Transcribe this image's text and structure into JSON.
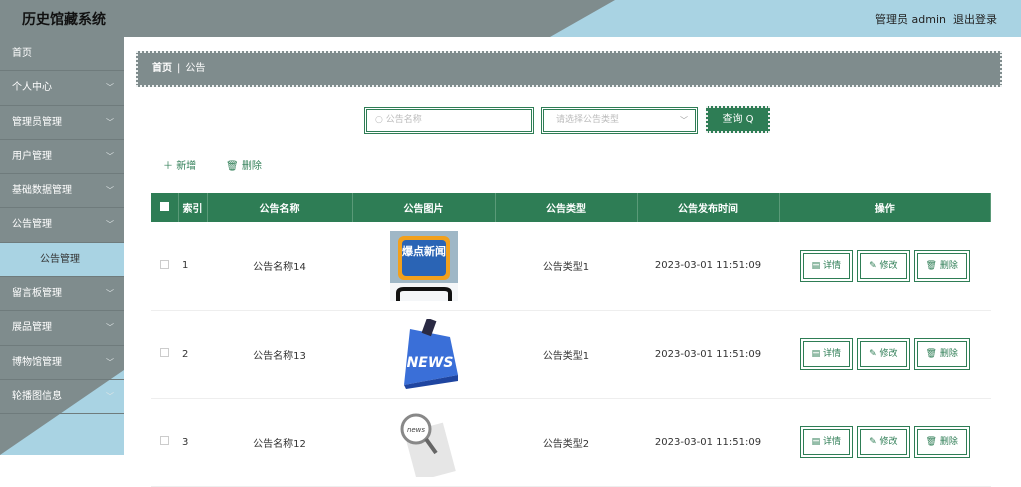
{
  "header": {
    "title": "历史馆藏系统",
    "user": "管理员 admin",
    "logout": "退出登录"
  },
  "sidebar": {
    "items": [
      {
        "label": "首页",
        "chev": ""
      },
      {
        "label": "个人中心",
        "chev": "﹀"
      },
      {
        "label": "管理员管理",
        "chev": "﹀"
      },
      {
        "label": "用户管理",
        "chev": "﹀"
      },
      {
        "label": "基础数据管理",
        "chev": "﹀"
      },
      {
        "label": "公告管理",
        "chev": "﹀"
      },
      {
        "label": "公告管理",
        "chev": ""
      },
      {
        "label": "留言板管理",
        "chev": "﹀"
      },
      {
        "label": "展品管理",
        "chev": "﹀"
      },
      {
        "label": "博物馆管理",
        "chev": "﹀"
      },
      {
        "label": "轮播图信息",
        "chev": "﹀"
      }
    ]
  },
  "breadcrumb": {
    "home": "首页",
    "sep": "|",
    "current": "公告"
  },
  "search": {
    "placeholder": "公告名称",
    "select_placeholder": "请选择公告类型",
    "button": "查询"
  },
  "actions": {
    "add": "新增",
    "delete": "删除"
  },
  "table": {
    "headers": [
      "索引",
      "公告名称",
      "公告图片",
      "公告类型",
      "公告发布时间",
      "操作"
    ],
    "rows": [
      {
        "index": "1",
        "name": "公告名称14",
        "image": "爆点新闻",
        "type": "公告类型1",
        "time": "2023-03-01 11:51:09"
      },
      {
        "index": "2",
        "name": "公告名称13",
        "image": "NEWS",
        "type": "公告类型1",
        "time": "2023-03-01 11:51:09"
      },
      {
        "index": "3",
        "name": "公告名称12",
        "image": "news",
        "type": "公告类型2",
        "time": "2023-03-01 11:51:09"
      }
    ],
    "ops": {
      "detail": "详情",
      "edit": "修改",
      "delete": "删除"
    }
  },
  "colors": {
    "accent": "#2e7d55",
    "gray": "#7f8c8d",
    "blue": "#a9d3e3"
  }
}
